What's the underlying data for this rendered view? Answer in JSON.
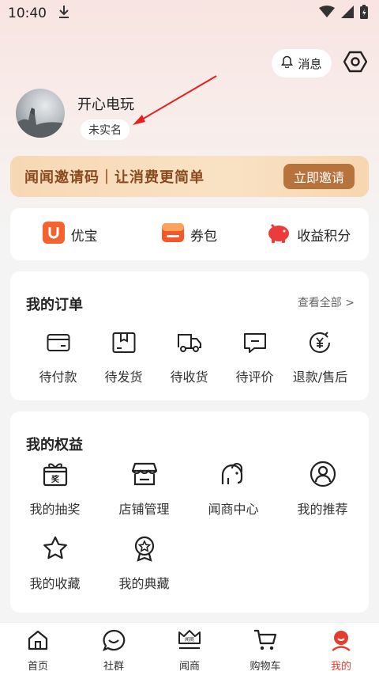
{
  "status_bar": {
    "time": "10:40"
  },
  "header": {
    "messages_label": "消息"
  },
  "profile": {
    "username": "开心电玩",
    "realname_status": "未实名"
  },
  "invite": {
    "text": "闻闻邀请码｜让消费更简单",
    "button_label": "立即邀请"
  },
  "quick_links": [
    {
      "label": "优宝",
      "icon": "youbao-icon"
    },
    {
      "label": "券包",
      "icon": "coupon-wallet-icon"
    },
    {
      "label": "收益积分",
      "icon": "piggy-bank-icon"
    }
  ],
  "orders": {
    "title": "我的订单",
    "view_all": "查看全部 >",
    "items": [
      {
        "label": "待付款",
        "icon": "wallet-icon"
      },
      {
        "label": "待发货",
        "icon": "package-icon"
      },
      {
        "label": "待收货",
        "icon": "truck-icon"
      },
      {
        "label": "待评价",
        "icon": "comment-icon"
      },
      {
        "label": "退款/售后",
        "icon": "refund-icon"
      }
    ]
  },
  "rights": {
    "title": "我的权益",
    "gift_box_text": "奖",
    "items": [
      {
        "label": "我的抽奖",
        "icon": "lottery-gift-icon"
      },
      {
        "label": "店铺管理",
        "icon": "shop-icon"
      },
      {
        "label": "闻商中心",
        "icon": "elephant-icon"
      },
      {
        "label": "我的推荐",
        "icon": "referral-user-icon"
      },
      {
        "label": "我的收藏",
        "icon": "star-icon"
      },
      {
        "label": "我的典藏",
        "icon": "medal-icon"
      }
    ]
  },
  "tabbar": {
    "active": "我的",
    "wenshang_logo_text": "闻商",
    "items": [
      {
        "label": "首页",
        "icon": "home-icon"
      },
      {
        "label": "社群",
        "icon": "chat-icon"
      },
      {
        "label": "闻商",
        "icon": "crown-shop-icon"
      },
      {
        "label": "购物车",
        "icon": "cart-icon"
      },
      {
        "label": "我的",
        "icon": "profile-icon"
      }
    ]
  },
  "colors": {
    "accent_red": "#e53c2f",
    "invite_brown": "#b8733d",
    "invite_text": "#8a4a1f",
    "banner_bg": "#f9e2c4"
  }
}
